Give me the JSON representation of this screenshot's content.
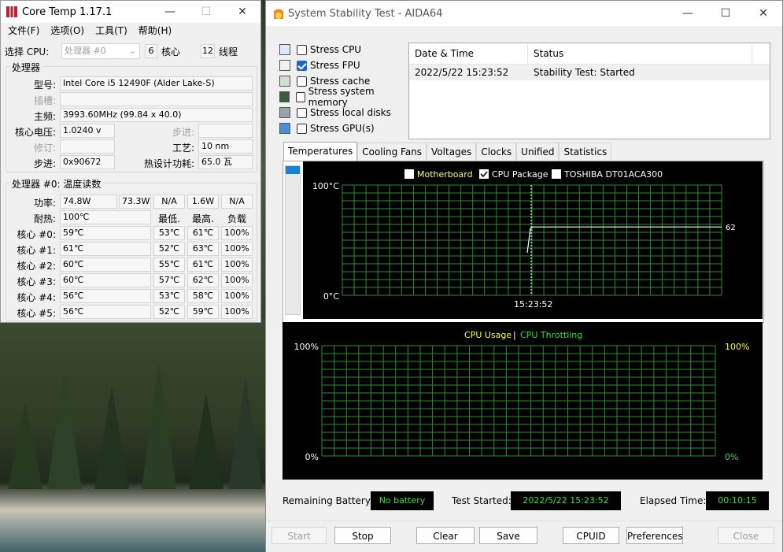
{
  "coretemp": {
    "title": "Core Temp 1.17.1",
    "menu": [
      "文件(F)",
      "选项(O)",
      "工具(T)",
      "帮助(H)"
    ],
    "select_cpu_label": "选择 CPU:",
    "select_cpu_value": "处理器 #0",
    "cores_count": "6",
    "cores_label": "核心",
    "threads_count": "12",
    "threads_label": "线程",
    "processor_group": "处理器",
    "model_label": "型号:",
    "model_value": "Intel Core i5 12490F (Alder Lake-S)",
    "socket_label": "插槽:",
    "socket_value": "",
    "freq_label": "主频:",
    "freq_value": "3993.60MHz (99.84 x 40.0)",
    "vid_label": "核心电压:",
    "vid_value": "1.0240 v",
    "stepping_label": "步进:",
    "stepping_value": "",
    "revision_label": "修订:",
    "revision_value": "",
    "lithography_label": "工艺:",
    "lithography_value": "10 nm",
    "cpuid_label": "步进:",
    "cpuid_value": "0x90672",
    "tdp_label": "热设计功耗:",
    "tdp_value": "65.0 瓦",
    "temps_group": "处理器 #0: 温度读数",
    "power_label": "功率:",
    "power_values": [
      "74.8W",
      "73.3W",
      "N/A",
      "1.6W",
      "N/A"
    ],
    "tjmax_label": "耐热:",
    "tjmax_value": "100℃",
    "col_min": "最低.",
    "col_max": "最高.",
    "col_load": "负载",
    "cores": [
      {
        "label": "核心 #0:",
        "temp": "59℃",
        "min": "53℃",
        "max": "61℃",
        "load": "100%"
      },
      {
        "label": "核心 #1:",
        "temp": "61℃",
        "min": "52℃",
        "max": "63℃",
        "load": "100%"
      },
      {
        "label": "核心 #2:",
        "temp": "60℃",
        "min": "55℃",
        "max": "61℃",
        "load": "100%"
      },
      {
        "label": "核心 #3:",
        "temp": "60℃",
        "min": "57℃",
        "max": "62℃",
        "load": "100%"
      },
      {
        "label": "核心 #4:",
        "temp": "56℃",
        "min": "53℃",
        "max": "58℃",
        "load": "100%"
      },
      {
        "label": "核心 #5:",
        "temp": "56℃",
        "min": "52℃",
        "max": "59℃",
        "load": "100%"
      }
    ]
  },
  "aida": {
    "title": "System Stability Test - AIDA64",
    "stress_items": [
      {
        "label": "Stress CPU",
        "checked": false,
        "icon": "cpu-icon"
      },
      {
        "label": "Stress FPU",
        "checked": true,
        "icon": "fpu-icon"
      },
      {
        "label": "Stress cache",
        "checked": false,
        "icon": "cache-icon"
      },
      {
        "label": "Stress system memory",
        "checked": false,
        "icon": "memory-icon"
      },
      {
        "label": "Stress local disks",
        "checked": false,
        "icon": "disk-icon"
      },
      {
        "label": "Stress GPU(s)",
        "checked": false,
        "icon": "gpu-icon"
      }
    ],
    "log_headers": [
      "Date & Time",
      "Status"
    ],
    "log_rows": [
      [
        "2022/5/22 15:23:52",
        "Stability Test: Started"
      ]
    ],
    "tabs": [
      "Temperatures",
      "Cooling Fans",
      "Voltages",
      "Clocks",
      "Unified",
      "Statistics"
    ],
    "active_tab": "Temperatures",
    "temp_legend": [
      {
        "label": "Motherboard",
        "checked": false,
        "color": "#ffff66"
      },
      {
        "label": "CPU Package",
        "checked": true,
        "color": "#ffffff"
      },
      {
        "label": "TOSHIBA DT01ACA300",
        "checked": false,
        "color": "#ffffff"
      }
    ],
    "temp_ymax_label": "100°C",
    "temp_ymin_label": "0°C",
    "temp_time_label": "15:23:52",
    "temp_current_label": "62",
    "usage_legend_a": "CPU Usage",
    "usage_sep": "|",
    "usage_legend_b": "CPU Throttling",
    "usage_left_top": "100%",
    "usage_left_bottom": "0%",
    "usage_right_top": "100%",
    "usage_right_bottom": "0%",
    "battery_label": "Remaining Battery:",
    "battery_value": "No battery",
    "started_label": "Test Started:",
    "started_value": "2022/5/22 15:23:52",
    "elapsed_label": "Elapsed Time:",
    "elapsed_value": "00:10:15",
    "buttons": {
      "start": "Start",
      "stop": "Stop",
      "clear": "Clear",
      "save": "Save",
      "cpuid": "CPUID",
      "prefs": "Preferences",
      "close": "Close"
    },
    "colors": {
      "grid": "#2e8b2e",
      "yellow": "#ffff33",
      "green": "#33dd33"
    }
  },
  "chart_data": [
    {
      "type": "line",
      "series": [
        {
          "name": "CPU Package",
          "x": [
            "15:23:52"
          ],
          "values": [
            62
          ]
        }
      ],
      "ylim": [
        0,
        100
      ],
      "ylabel": "°C",
      "grid": true,
      "legend": "top"
    },
    {
      "type": "line",
      "series": [
        {
          "name": "CPU Usage",
          "values": [
            100
          ]
        },
        {
          "name": "CPU Throttling",
          "values": [
            0
          ]
        }
      ],
      "ylim": [
        0,
        100
      ],
      "grid": true,
      "legend": "top"
    }
  ]
}
